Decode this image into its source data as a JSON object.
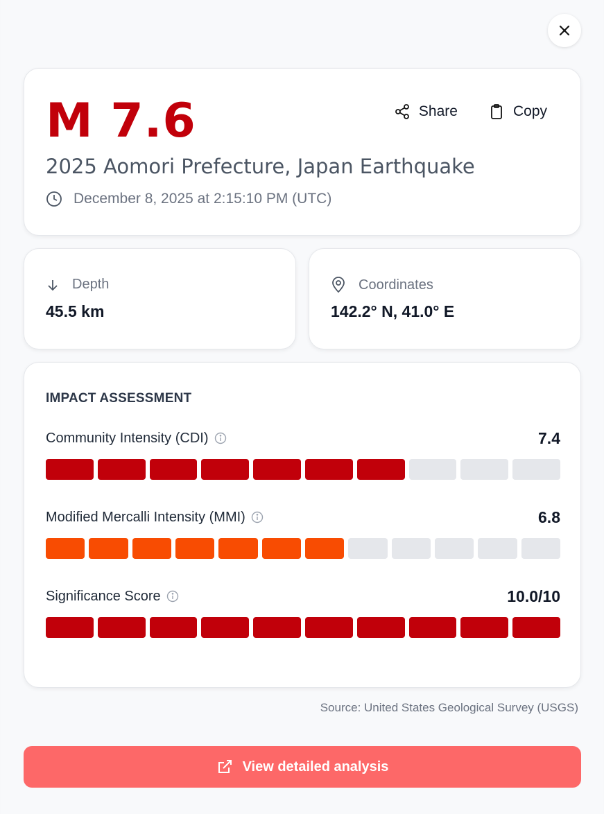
{
  "close": {
    "icon": "close-icon"
  },
  "event": {
    "magnitude": "M 7.6",
    "title": "2025 Aomori Prefecture, Japan Earthquake",
    "datetime": "December 8, 2025 at 2:15:10 PM (UTC)",
    "share_label": "Share",
    "copy_label": "Copy"
  },
  "stats": {
    "depth": {
      "label": "Depth",
      "value": "45.5 km"
    },
    "coordinates": {
      "label": "Coordinates",
      "value": "142.2° N, 41.0° E"
    }
  },
  "impact": {
    "heading": "IMPACT ASSESSMENT",
    "metrics": [
      {
        "label": "Community Intensity (CDI)",
        "value": "7.4",
        "segments_total": 10,
        "segments_filled": 7,
        "fill_color": "#c1000a"
      },
      {
        "label": "Modified Mercalli Intensity (MMI)",
        "value": "6.8",
        "segments_total": 12,
        "segments_filled": 7,
        "fill_color": "#f84c02"
      },
      {
        "label": "Significance Score",
        "value": "10.0/10",
        "segments_total": 10,
        "segments_filled": 10,
        "fill_color": "#c1000a"
      }
    ]
  },
  "source": "Source: United States Geological Survey (USGS)",
  "cta": {
    "label": "View detailed analysis",
    "icon": "external-link-icon"
  },
  "colors": {
    "accent": "#c1000a",
    "cta_bg": "#fd6868",
    "empty_segment": "#e5e7eb"
  }
}
